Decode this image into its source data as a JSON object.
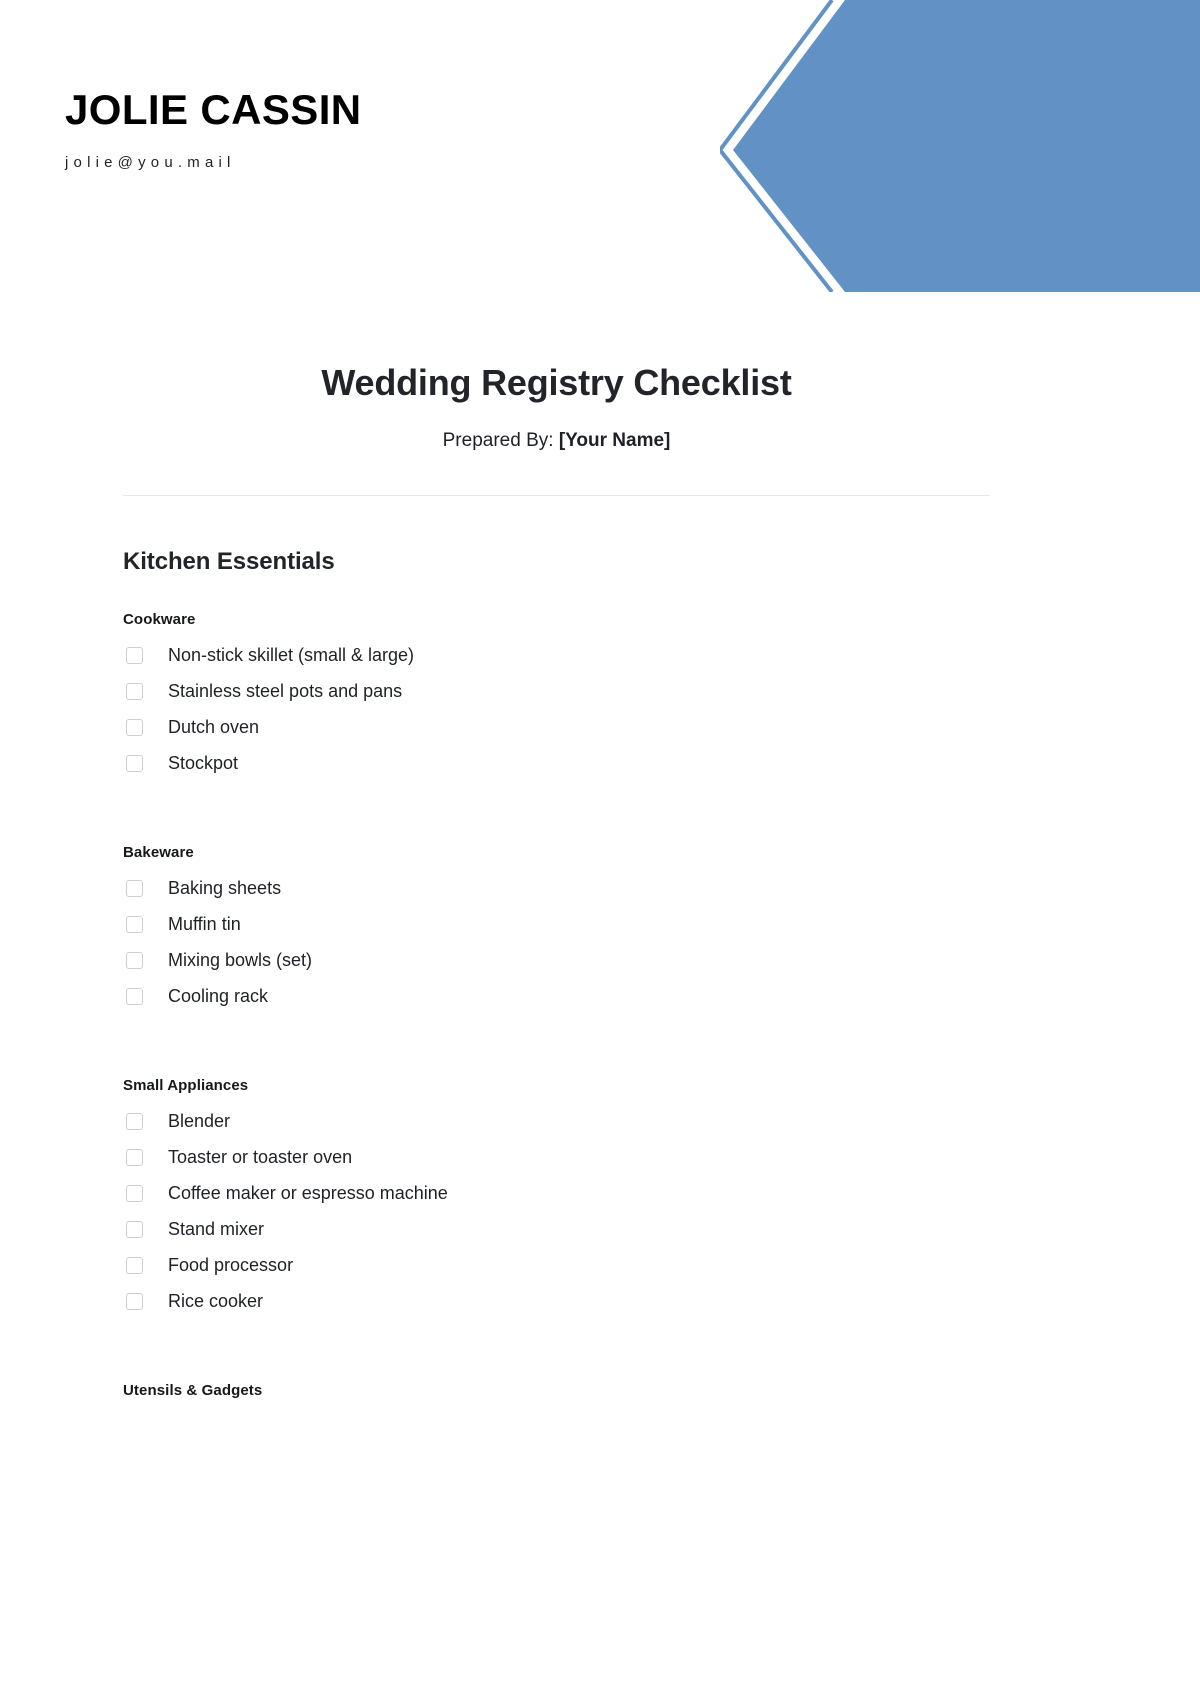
{
  "letterhead": {
    "brand_name": "JOLIE CASSIN",
    "email": "jolie@you.mail"
  },
  "banner": {
    "shape": "left-pointing-chevron",
    "fill_color": "#6292c5",
    "outline_color": "#6292c5"
  },
  "document": {
    "title": "Wedding Registry Checklist",
    "prepared_by_label": "Prepared By:",
    "prepared_by_value": "[Your Name]"
  },
  "sections": [
    {
      "title": "Kitchen Essentials",
      "groups": [
        {
          "title": "Cookware",
          "items": [
            {
              "label": "Non-stick skillet (small & large)",
              "checked": false
            },
            {
              "label": "Stainless steel pots and pans",
              "checked": false
            },
            {
              "label": "Dutch oven",
              "checked": false
            },
            {
              "label": "Stockpot",
              "checked": false
            }
          ]
        },
        {
          "title": "Bakeware",
          "items": [
            {
              "label": "Baking sheets",
              "checked": false
            },
            {
              "label": "Muffin tin",
              "checked": false
            },
            {
              "label": "Mixing bowls (set)",
              "checked": false
            },
            {
              "label": "Cooling rack",
              "checked": false
            }
          ]
        },
        {
          "title": "Small Appliances",
          "items": [
            {
              "label": "Blender",
              "checked": false
            },
            {
              "label": "Toaster or toaster oven",
              "checked": false
            },
            {
              "label": "Coffee maker or espresso machine",
              "checked": false
            },
            {
              "label": "Stand mixer",
              "checked": false
            },
            {
              "label": "Food processor",
              "checked": false
            },
            {
              "label": "Rice cooker",
              "checked": false
            }
          ]
        },
        {
          "title": "Utensils & Gadgets",
          "items": []
        }
      ]
    }
  ]
}
